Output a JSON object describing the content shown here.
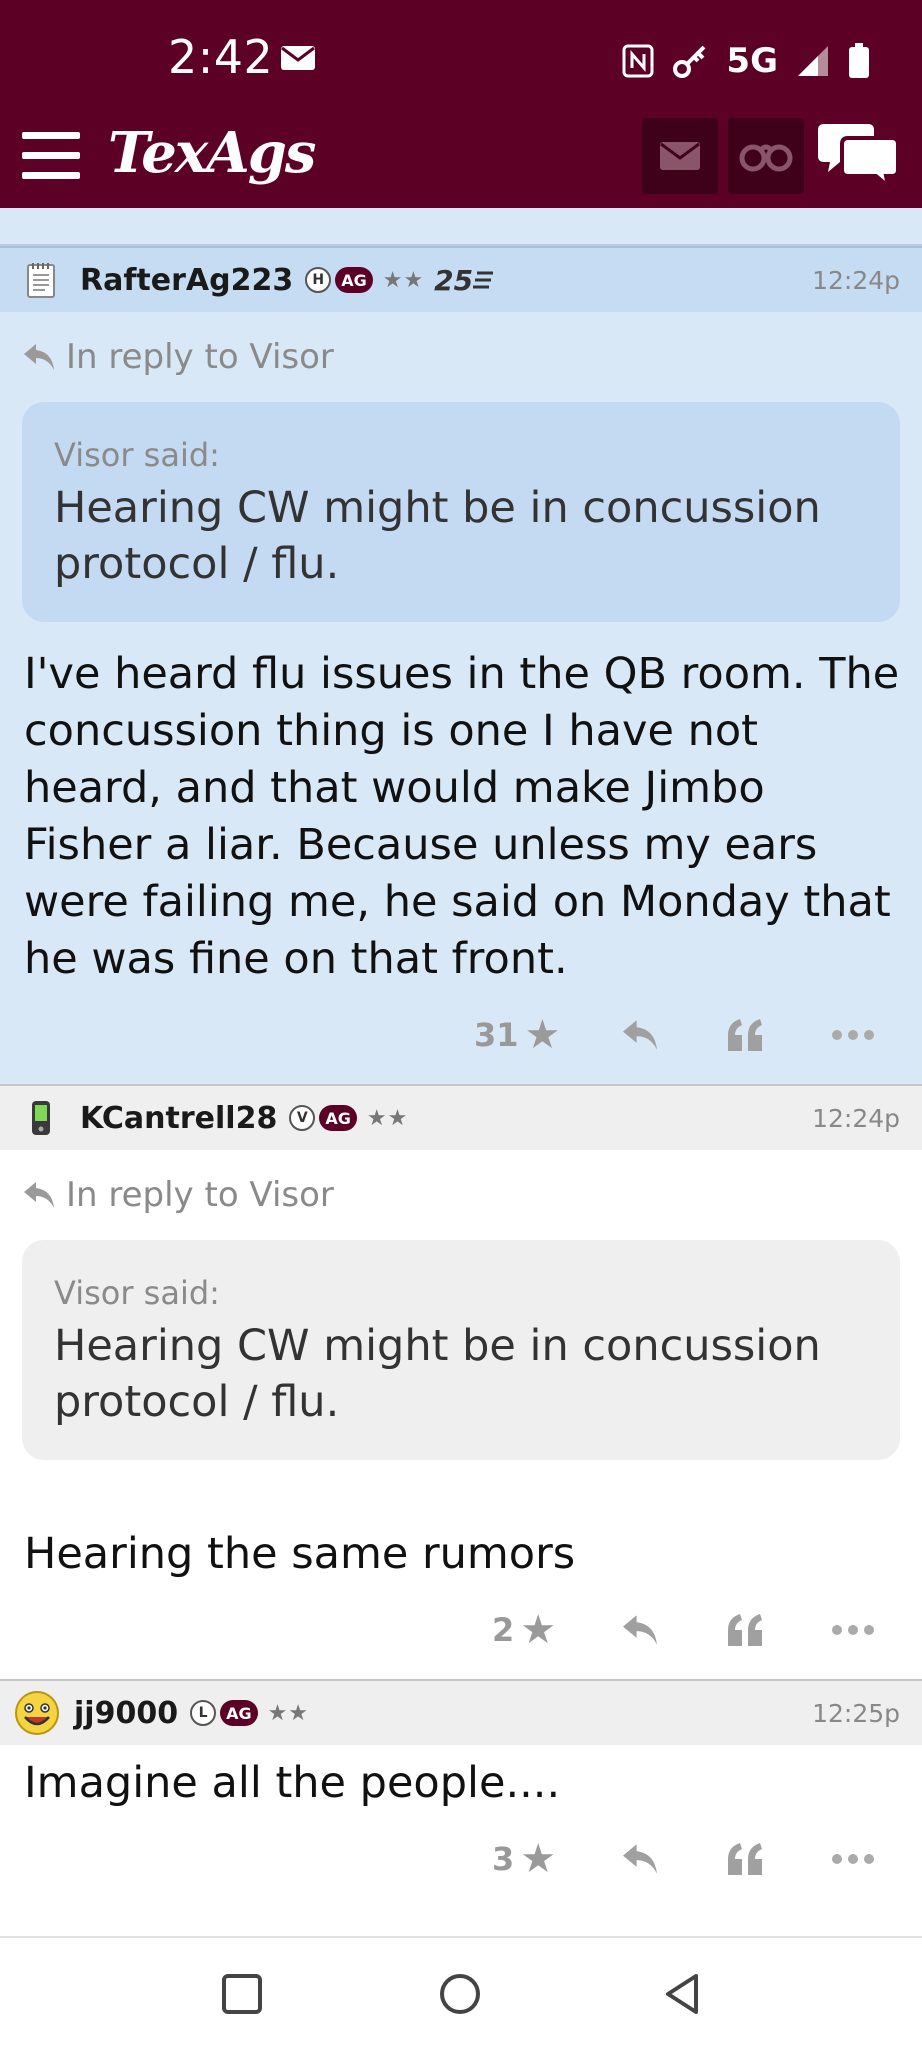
{
  "status_bar": {
    "time": "2:42",
    "network": "5G"
  },
  "header": {
    "brand": "TexAgs"
  },
  "colors": {
    "maroon": "#5c0025",
    "highlight_bg": "#d8e8f7"
  },
  "posts": [
    {
      "username": "RafterAg223",
      "badge_letter": "H",
      "badge_ag": "AG",
      "stars": "★★",
      "rank": "25",
      "time": "12:24p",
      "avatar_icon": "notepad-icon",
      "reply_to": "In reply to Visor",
      "quote_author": "Visor said:",
      "quote_text": "Hearing CW might be in concussion protocol / flu.",
      "body": "I've heard flu issues in the QB room. The concussion thing is one I have not heard, and that would make Jimbo Fisher a liar. Because unless my ears were failing me, he said on Monday that he was fine on that front.",
      "star_count": "31"
    },
    {
      "username": "KCantrell28",
      "badge_letter": "V",
      "badge_ag": "AG",
      "stars": "★★",
      "time": "12:24p",
      "avatar_icon": "phone-icon",
      "reply_to": "In reply to Visor",
      "quote_author": "Visor said:",
      "quote_text": "Hearing CW might be in concussion protocol / flu.",
      "body": "Hearing the same rumors",
      "star_count": "2"
    },
    {
      "username": "jj9000",
      "badge_letter": "L",
      "badge_ag": "AG",
      "stars": "★★",
      "time": "12:25p",
      "avatar_icon": "smiley-icon",
      "body": "Imagine all the people....",
      "star_count": "3"
    }
  ]
}
